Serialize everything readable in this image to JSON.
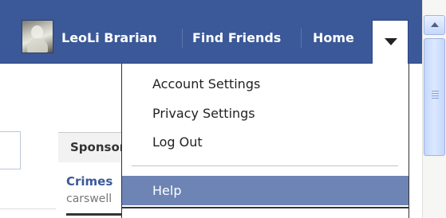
{
  "topbar": {
    "user_name": "LeoLi Brarian",
    "find_friends": "Find Friends",
    "home": "Home",
    "background_color": "#3b5998"
  },
  "menu": {
    "items": [
      {
        "label": "Account Settings"
      },
      {
        "label": "Privacy Settings"
      },
      {
        "label": "Log Out"
      },
      {
        "label": "Help"
      }
    ],
    "highlight_color": "#6d84b4"
  },
  "sponsored": {
    "header": "Sponsored",
    "ad_title": "Crimes",
    "ad_domain": "carswell"
  },
  "icons": [
    "avatar-photo",
    "chevron-down-icon",
    "scroll-up-arrow-icon"
  ]
}
